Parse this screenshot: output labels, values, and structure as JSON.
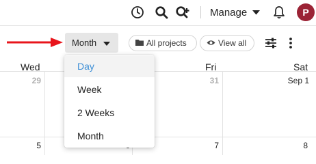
{
  "topbar": {
    "manage_label": "Manage",
    "avatar_letter": "P",
    "icons": [
      "clock-icon",
      "search-icon",
      "quick-add-icon",
      "caret-down-icon",
      "bell-icon",
      "avatar"
    ]
  },
  "toolbar": {
    "view_button_label": "Month",
    "all_projects_label": "All projects",
    "view_all_label": "View all",
    "icons": [
      "folder-icon",
      "eye-icon",
      "sliders-icon",
      "more-vertical-icon"
    ],
    "annotation_color": "#e8141b"
  },
  "calendar": {
    "day_headers": [
      "Wed",
      "Fri",
      "Sat"
    ],
    "week1": {
      "wed": "29",
      "thu": "31",
      "sat": "Sep 1"
    },
    "week2": {
      "wed": "5",
      "thu_partial": "6",
      "fri": "7",
      "sat": "8"
    }
  },
  "view_menu": {
    "options": [
      "Day",
      "Week",
      "2 Weeks",
      "Month"
    ],
    "active_index": 0,
    "active_color": "#3d8fd6"
  }
}
